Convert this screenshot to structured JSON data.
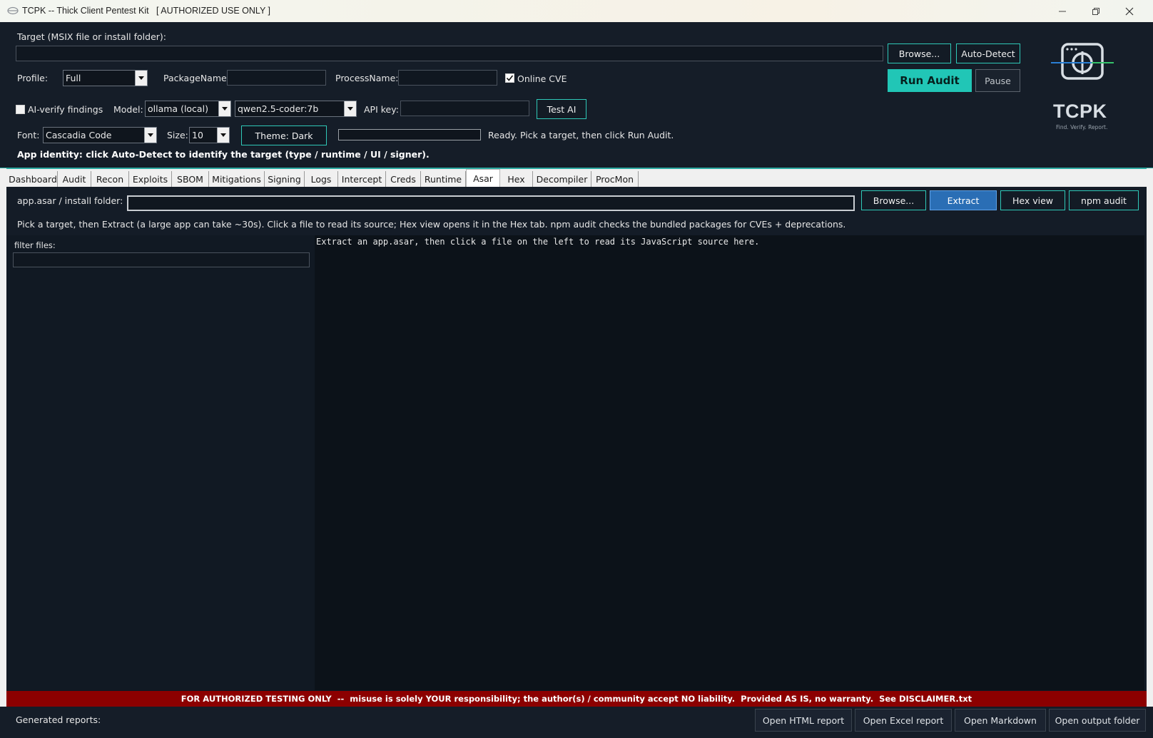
{
  "window": {
    "title": "TCPK -- Thick Client Pentest Kit   [ AUTHORIZED USE ONLY ]"
  },
  "header": {
    "target_label": "Target (MSIX file or install folder):",
    "target_value": "",
    "browse_label": "Browse...",
    "autodetect_label": "Auto-Detect",
    "profile_label": "Profile:",
    "profile_value": "Full",
    "package_label": "PackageName:",
    "package_value": "",
    "process_label": "ProcessName:",
    "process_value": "",
    "online_cve_label": "Online CVE",
    "online_cve_checked": true,
    "run_audit_label": "Run Audit",
    "pause_label": "Pause",
    "ai_verify_label": "AI-verify findings",
    "ai_verify_checked": false,
    "model_label": "Model:",
    "model_provider": "ollama (local)",
    "model_name": "qwen2.5-coder:7b",
    "api_key_label": "API key:",
    "api_key_value": "",
    "test_ai_label": "Test AI",
    "font_label": "Font:",
    "font_value": "Cascadia Code",
    "size_label": "Size:",
    "size_value": "10",
    "theme_label": "Theme: Dark",
    "status_text": "Ready. Pick a target, then click Run Audit.",
    "identity_text": "App identity: click Auto-Detect to identify the target (type / runtime / UI / signer)."
  },
  "logo": {
    "name": "TCPK",
    "tagline": "Find. Verify. Report.",
    "icon": "crosshair-window-icon"
  },
  "tabs": [
    {
      "label": "Dashboard"
    },
    {
      "label": "Audit"
    },
    {
      "label": "Recon"
    },
    {
      "label": "Exploits"
    },
    {
      "label": "SBOM"
    },
    {
      "label": "Mitigations"
    },
    {
      "label": "Signing"
    },
    {
      "label": "Logs"
    },
    {
      "label": "Intercept"
    },
    {
      "label": "Creds"
    },
    {
      "label": "Runtime"
    },
    {
      "label": "Asar"
    },
    {
      "label": "Hex"
    },
    {
      "label": "Decompiler"
    },
    {
      "label": "ProcMon"
    }
  ],
  "active_tab": "Asar",
  "asar": {
    "folder_label": "app.asar / install folder:",
    "folder_value": "",
    "browse_label": "Browse...",
    "extract_label": "Extract",
    "hex_view_label": "Hex view",
    "npm_audit_label": "npm audit",
    "help_text": "Pick a target, then Extract (a large app can take ~30s). Click a file to read its source; Hex view opens it in the Hex tab. npm audit checks the bundled packages for CVEs + deprecations.",
    "filter_label": "filter files:",
    "filter_value": "",
    "viewer_text": "Extract an app.asar, then click a file on the left to read its JavaScript source here."
  },
  "footer": {
    "disclaimer": "FOR AUTHORIZED TESTING ONLY  --  misuse is solely YOUR responsibility; the author(s) / community accept NO liability.  Provided AS IS, no warranty.  See DISCLAIMER.txt",
    "reports_label": "Generated reports:",
    "open_html_label": "Open HTML report",
    "open_excel_label": "Open Excel report",
    "open_markdown_label": "Open Markdown",
    "open_output_label": "Open output folder"
  },
  "colors": {
    "accent": "#21c6b6",
    "disclaimer_bg": "#8c0000",
    "primary_button": "#2a6eb5",
    "background": "#151d28"
  }
}
